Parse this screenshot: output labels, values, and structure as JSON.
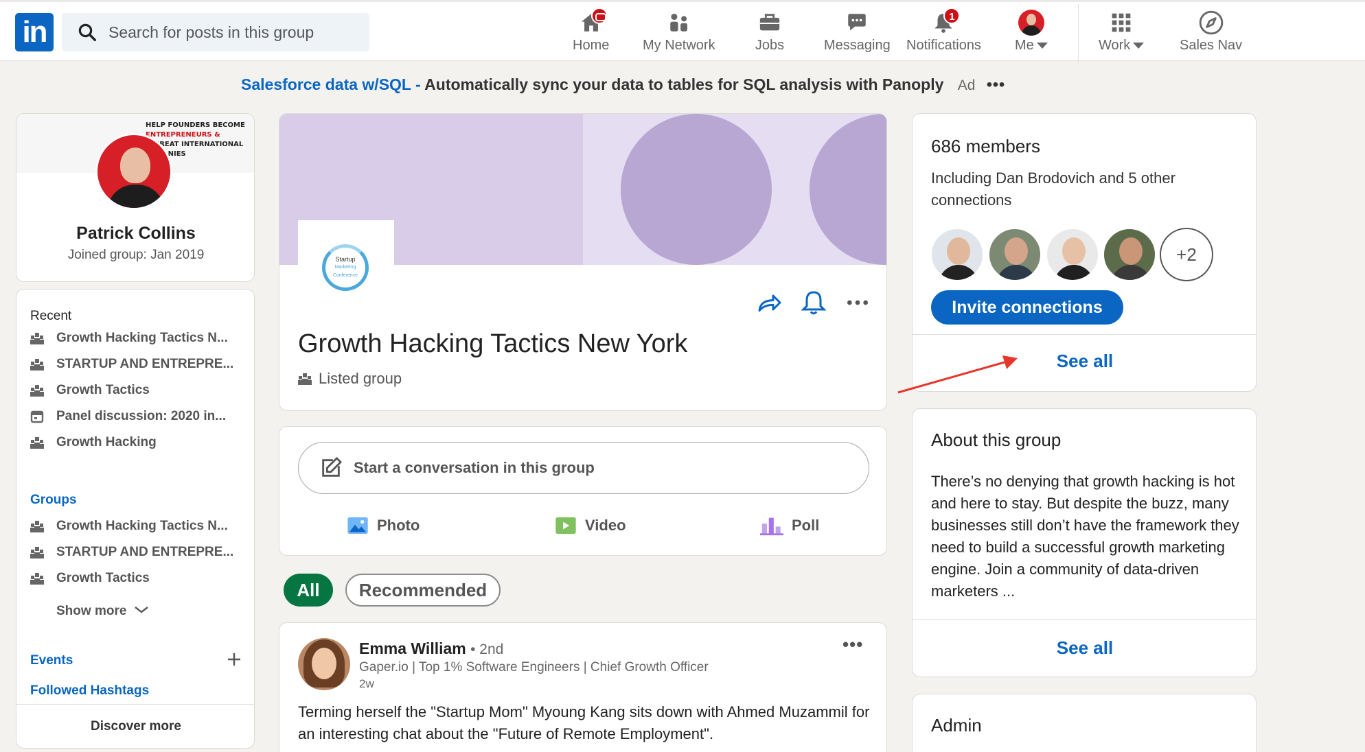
{
  "nav": {
    "search_placeholder": "Search for posts in this group",
    "items": [
      {
        "label": "Home",
        "icon": "home-icon",
        "badge": ""
      },
      {
        "label": "My Network",
        "icon": "network-icon",
        "badge": ""
      },
      {
        "label": "Jobs",
        "icon": "briefcase-icon",
        "badge": ""
      },
      {
        "label": "Messaging",
        "icon": "messaging-icon",
        "badge": ""
      },
      {
        "label": "Notifications",
        "icon": "bell-icon",
        "badge": "1"
      },
      {
        "label": "Me",
        "icon": "avatar",
        "badge": ""
      },
      {
        "label": "Work",
        "icon": "grid-icon",
        "badge": ""
      },
      {
        "label": "Sales Nav",
        "icon": "compass-icon",
        "badge": ""
      }
    ]
  },
  "ad": {
    "link": "Salesforce data w/SQL -",
    "text": "Automatically sync your data to tables for SQL analysis with Panoply",
    "label": "Ad",
    "more": "•••"
  },
  "profile": {
    "banner_lines": [
      "HELP FOUNDERS BECOME",
      "ENTREPRENEURS &",
      "O GREAT INTERNATIONAL",
      "OMPANIES"
    ],
    "name": "Patrick Collins",
    "joined": "Joined group: Jan 2019"
  },
  "leftnav": {
    "recent_heading": "Recent",
    "recent": [
      "Growth Hacking Tactics N...",
      "STARTUP AND ENTREPRE...",
      "Growth Tactics",
      "Panel discussion: 2020 in...",
      "Growth Hacking"
    ],
    "groups_heading": "Groups",
    "groups": [
      "Growth Hacking Tactics N...",
      "STARTUP AND ENTREPRE...",
      "Growth Tactics"
    ],
    "show_more": "Show more",
    "events": "Events",
    "hashtags": "Followed Hashtags",
    "discover": "Discover more"
  },
  "group": {
    "logo_text": "Startup",
    "logo_sub": "Marketing Conference",
    "title": "Growth Hacking Tactics New York",
    "type": "Listed group"
  },
  "composer": {
    "placeholder": "Start a conversation in this group",
    "photo": "Photo",
    "video": "Video",
    "poll": "Poll"
  },
  "filters": {
    "all": "All",
    "recommended": "Recommended"
  },
  "post": {
    "author": "Emma William",
    "degree": "• 2nd",
    "headline": "Gaper.io | Top 1% Software Engineers | Chief Growth Officer",
    "time": "2w",
    "more": "•••",
    "body": "Terming herself the \"Startup Mom\" Myoung Kang sits down with Ahmed Muzammil for an interesting chat about the \"Future of Remote Employment\"."
  },
  "members": {
    "count": "686 members",
    "including": "Including Dan Brodovich and 5 other connections",
    "more_count": "+2",
    "invite": "Invite connections",
    "see_all": "See all"
  },
  "about": {
    "title": "About this group",
    "body": "There’s no denying that growth hacking is hot and here to stay. But despite the buzz, many businesses still don’t have the framework they need to build a successful growth marketing engine. Join a community of data-driven marketers ...",
    "see_all": "See all"
  },
  "admin": {
    "title": "Admin"
  },
  "colors": {
    "brand": "#0a66c2",
    "active_pill": "#057642",
    "badge": "#cc1016",
    "annotation_arrow": "#e8362a"
  }
}
